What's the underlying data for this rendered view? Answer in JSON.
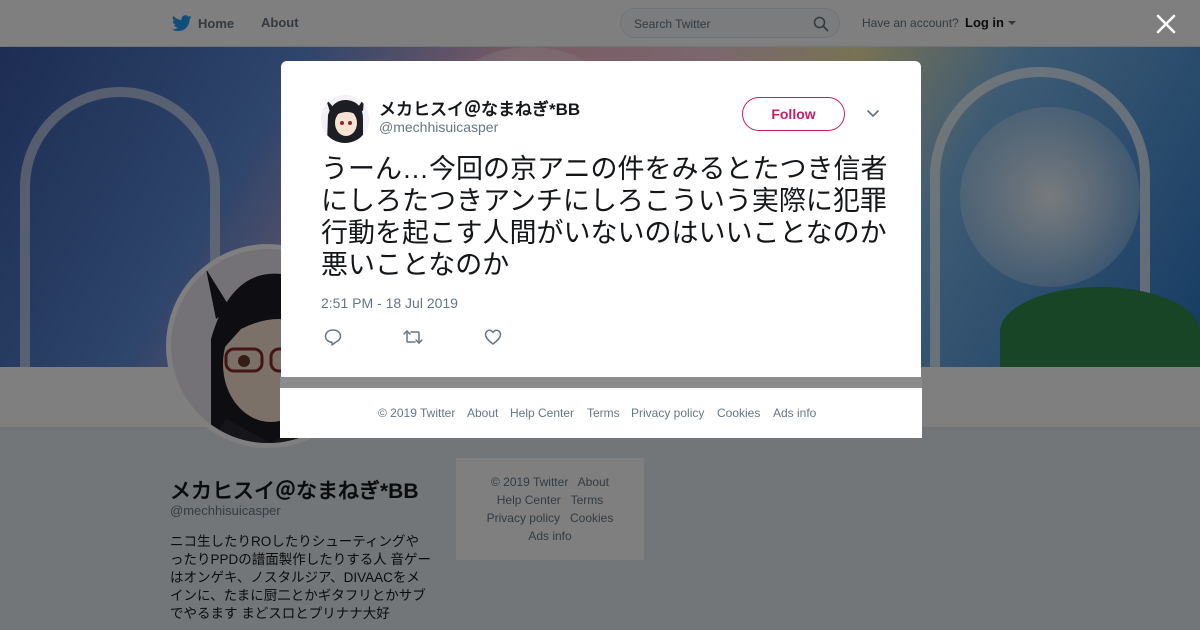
{
  "topbar": {
    "home_label": "Home",
    "about_label": "About",
    "search_placeholder": "Search Twitter",
    "account_prompt": "Have an account?",
    "login_label": "Log in"
  },
  "profile": {
    "name": "メカヒスイ＠なまねぎ*BB",
    "handle": "@mechhisuicasper",
    "bio": "ニコ生したりROしたりシューティングやったりPPDの譜面製作したりする人 音ゲーはオンゲキ、ノスタルジア、DIVAACをメインに、たまに厨二とかギタフリとかサブでやるます まどスロとプリナナ大好"
  },
  "side_footer": {
    "row1": [
      "© 2019 Twitter",
      "About"
    ],
    "row2": [
      "Help Center",
      "Terms"
    ],
    "row3": [
      "Privacy policy",
      "Cookies"
    ],
    "row4": [
      "Ads info"
    ]
  },
  "tweet": {
    "author_name": "メカヒスイ＠なまねぎ*BB",
    "author_handle": "@mechhisuicasper",
    "follow_label": "Follow",
    "text": "うーん…今回の京アニの件をみるとたつき信者にしろたつきアンチにしろこういう実際に犯罪行動を起こす人間がいないのはいいことなのか悪いことなのか",
    "timestamp": "2:51 PM - 18 Jul 2019"
  },
  "modal_footer": {
    "items": [
      "© 2019 Twitter",
      "About",
      "Help Center",
      "Terms",
      "Privacy policy",
      "Cookies",
      "Ads info"
    ]
  },
  "colors": {
    "brand_blue": "#1da1f2",
    "follow_accent": "#c71e63",
    "muted": "#657786"
  },
  "icons": [
    "twitter-bird-icon",
    "search-icon",
    "close-icon",
    "chevron-down-icon",
    "reply-icon",
    "retweet-icon",
    "like-icon"
  ]
}
